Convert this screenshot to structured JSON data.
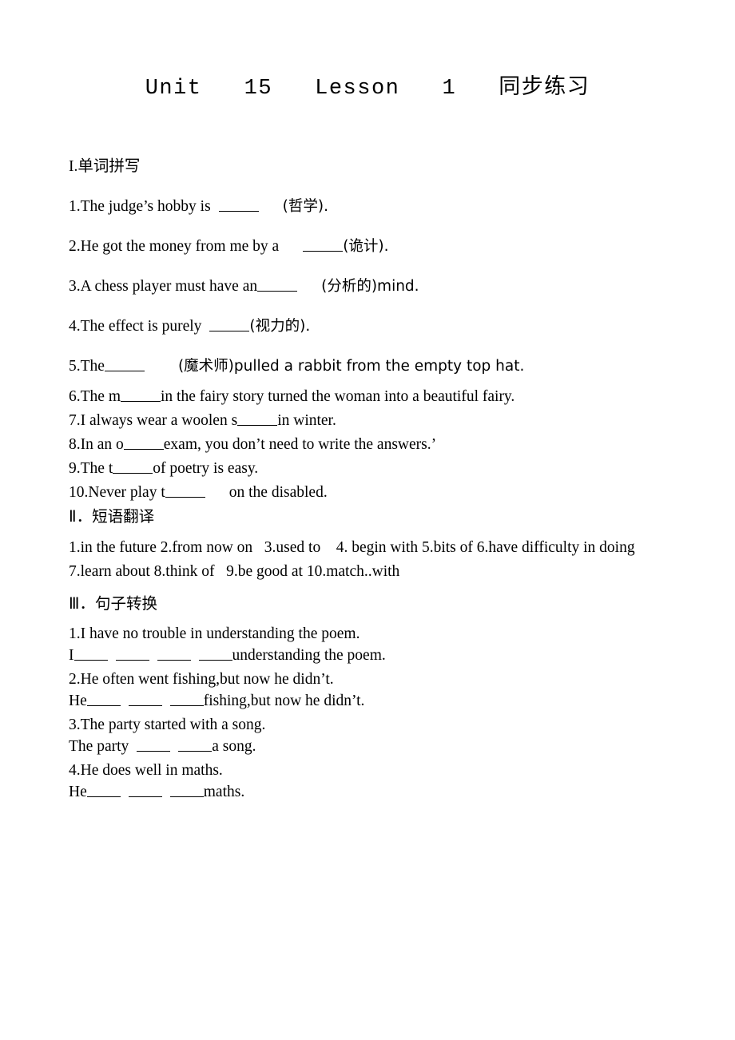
{
  "document": {
    "title": "Unit   15   Lesson   1   同步练习",
    "sections": [
      {
        "id": "section-1",
        "heading": "I.单词拼写",
        "items": [
          {
            "n": "1.",
            "pre": "1.The judge’s hobby is",
            "post": "(哲学)."
          },
          {
            "n": "2.",
            "pre": "2.He got the money from me by a",
            "post": "(诡计)."
          },
          {
            "n": "3.",
            "pre": "3.A chess player must have an",
            "post": "(分析的)mind."
          },
          {
            "n": "4.",
            "pre": "4.The effect is purely",
            "post": "(视力的)."
          },
          {
            "n": "5.",
            "pre": "5.The",
            "post": "(魔术师)pulled a rabbit from the empty top hat."
          },
          {
            "n": "6.",
            "pre": "6.The m",
            "post": "in the fairy story turned the woman into a beautiful fairy."
          },
          {
            "n": "7.",
            "pre": "7.I always wear a woolen s",
            "post": "in winter."
          },
          {
            "n": "8.",
            "pre": "8.In an o",
            "post": "exam, you don’t need to write the answers.’"
          },
          {
            "n": "9.",
            "pre": "9.The t",
            "post": "of poetry is easy."
          },
          {
            "n": "10.",
            "pre": "10.Never play t",
            "post": "on the disabled."
          }
        ]
      },
      {
        "id": "section-2",
        "heading": "Ⅱ．短语翻译",
        "lines": [
          "1.in the future 2.from now on   3.used to    4. begin with 5.bits of 6.have difficulty in doing",
          "7.learn about 8.think of   9.be good at 10.match..with"
        ]
      },
      {
        "id": "section-3",
        "heading": "Ⅲ．句子转换",
        "items": [
          {
            "prompt": "1.I have no trouble in understanding the poem.",
            "answer_pre": "I",
            "answer_post": "understanding the poem.",
            "blanks": 4
          },
          {
            "prompt": "2.He often went fishing,but now he didn’t.",
            "answer_pre": "He",
            "answer_post": "fishing,but now he didn’t.",
            "blanks": 3
          },
          {
            "prompt": "3.The party started with a song.",
            "answer_pre": "The party",
            "answer_post": "a song.",
            "blanks": 2
          },
          {
            "prompt": "4.He does well in maths.",
            "answer_pre": "He",
            "answer_post": "maths.",
            "blanks": 3
          }
        ]
      }
    ]
  }
}
